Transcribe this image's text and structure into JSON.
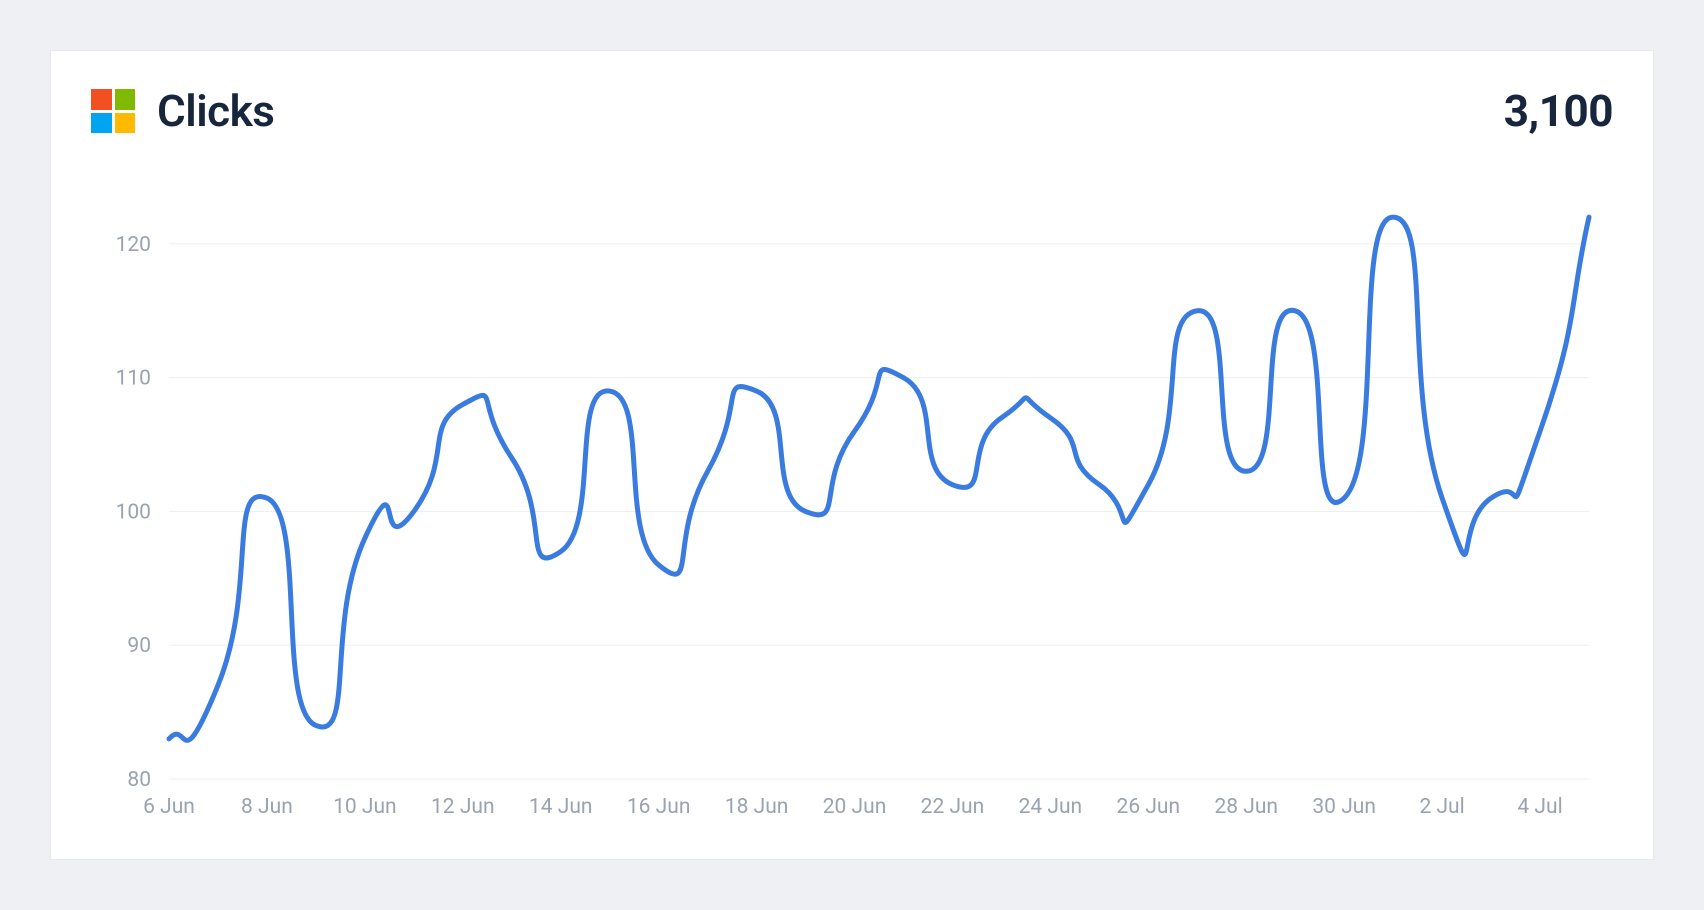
{
  "colors": {
    "ms_red": "#f25022",
    "ms_green": "#7fba00",
    "ms_blue": "#00a4ef",
    "ms_yellow": "#ffb900",
    "series": "#3a7be0"
  },
  "header": {
    "title": "Clicks",
    "metric": "3,100"
  },
  "chart_data": {
    "type": "line",
    "title": "Clicks",
    "xlabel": "",
    "ylabel": "",
    "ylim": [
      80,
      125
    ],
    "y_ticks": [
      80,
      90,
      100,
      110,
      120
    ],
    "x_tick_labels": [
      "6 Jun",
      "8 Jun",
      "10 Jun",
      "12 Jun",
      "14 Jun",
      "16 Jun",
      "18 Jun",
      "20 Jun",
      "22 Jun",
      "24 Jun",
      "26 Jun",
      "28 Jun",
      "30 Jun",
      "2 Jul",
      "4 Jul"
    ],
    "x": [
      "6 Jun",
      "7 Jun",
      "8 Jun",
      "9 Jun",
      "10 Jun",
      "11 Jun",
      "12 Jun",
      "13 Jun",
      "14 Jun",
      "15 Jun",
      "16 Jun",
      "17 Jun",
      "18 Jun",
      "19 Jun",
      "20 Jun",
      "21 Jun",
      "22 Jun",
      "23 Jun",
      "24 Jun",
      "25 Jun",
      "26 Jun",
      "27 Jun",
      "28 Jun",
      "29 Jun",
      "30 Jun",
      "1 Jul",
      "2 Jul",
      "3 Jul",
      "4 Jul",
      "5 Jul"
    ],
    "series": [
      {
        "name": "Clicks",
        "values": [
          83,
          87,
          101,
          84,
          98,
          100,
          108,
          104,
          97,
          109,
          96,
          103,
          109,
          100,
          106,
          110,
          102,
          107,
          107,
          102,
          102,
          115,
          103,
          115,
          101,
          122,
          101,
          101,
          106,
          122
        ]
      }
    ]
  }
}
